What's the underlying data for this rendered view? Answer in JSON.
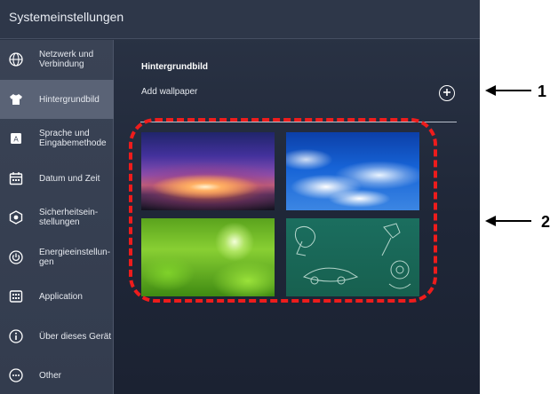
{
  "window": {
    "title": "Systemeinstellungen"
  },
  "sidebar": {
    "items": [
      {
        "label": "Netzwerk und\nVerbindung",
        "icon": "globe-icon",
        "active": false
      },
      {
        "label": "Hintergrundbild",
        "icon": "shirt-icon",
        "active": true
      },
      {
        "label": "Sprache und\nEingabemethode",
        "icon": "keyboard-a-icon",
        "active": false
      },
      {
        "label": "Datum und Zeit",
        "icon": "calendar-icon",
        "active": false
      },
      {
        "label": "Sicherheitsein-\nstellungen",
        "icon": "shield-icon",
        "active": false
      },
      {
        "label": "Energieeinstellun-\ngen",
        "icon": "power-icon",
        "active": false
      },
      {
        "label": "Application",
        "icon": "grid-icon",
        "active": false
      },
      {
        "label": "Über dieses Gerät",
        "icon": "info-icon",
        "active": false
      },
      {
        "label": "Other",
        "icon": "more-icon",
        "active": false
      }
    ]
  },
  "main": {
    "section_title": "Hintergrundbild",
    "add_label": "Add wallpaper",
    "add_icon": "plus-circle-icon",
    "wallpapers": [
      {
        "name": "sunset-wallpaper"
      },
      {
        "name": "clouds-wallpaper"
      },
      {
        "name": "leaves-wallpaper"
      },
      {
        "name": "sketch-wallpaper"
      }
    ]
  },
  "callouts": [
    {
      "number": "1",
      "target": "add-wallpaper-button"
    },
    {
      "number": "2",
      "target": "wallpaper-grid"
    }
  ],
  "colors": {
    "callout_red": "#ee1c1c",
    "active_item": "#5a6376",
    "background": "#1f2738"
  }
}
